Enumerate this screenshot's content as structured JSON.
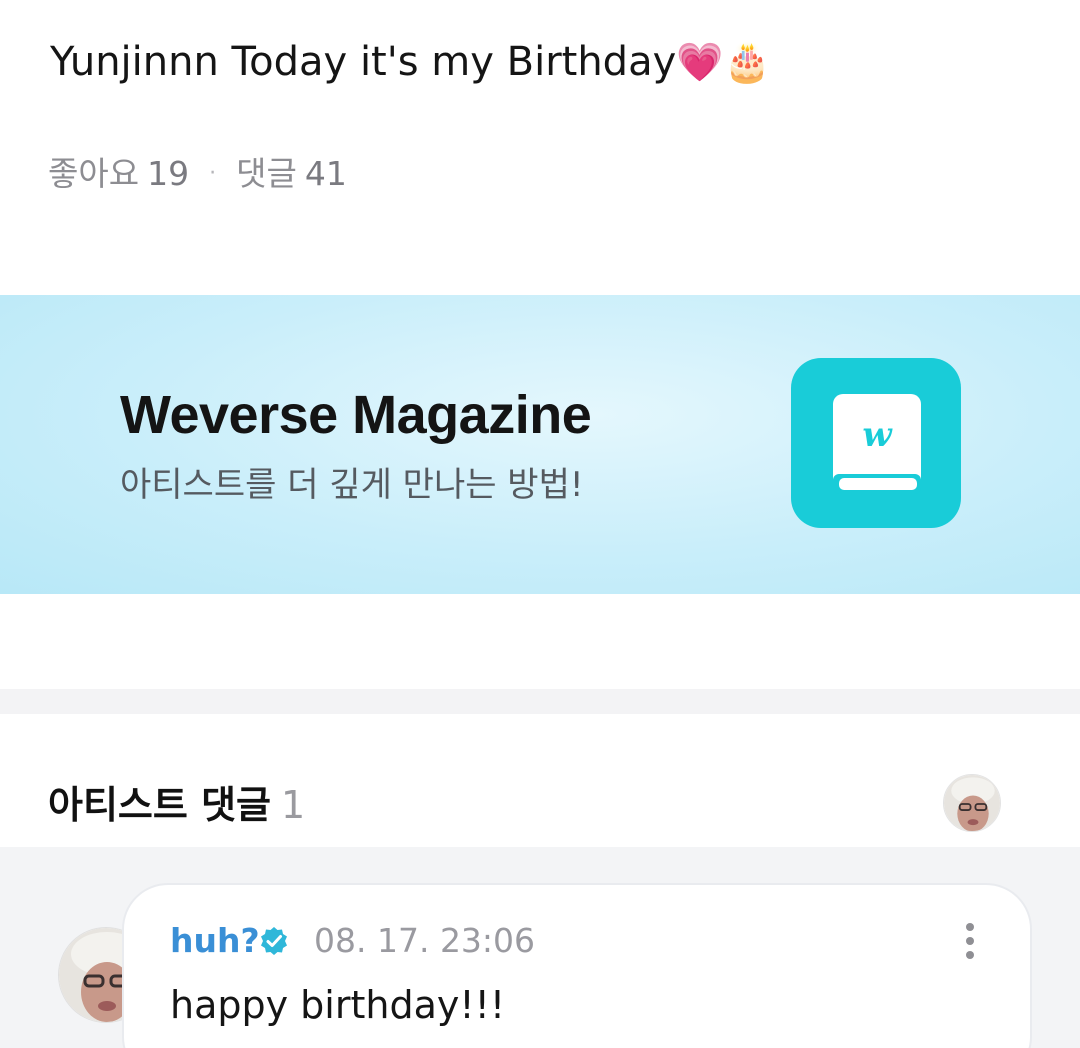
{
  "post": {
    "text": "Yunjinnn Today it's my Birthday",
    "emoji_heart": "💗",
    "emoji_cake": "🎂",
    "likes_label": "좋아요",
    "likes_count": "19",
    "separator": "·",
    "comments_label": "댓글",
    "comments_count": "41"
  },
  "banner": {
    "title": "Weverse Magazine",
    "subtitle": "아티스트를 더 깊게 만나는 방법!",
    "icon_name": "weverse-magazine-book-icon",
    "icon_bg": "#19ccd8"
  },
  "artist_comments": {
    "title": "아티스트 댓글",
    "count": "1"
  },
  "comment": {
    "author": "huh?",
    "timestamp": "08. 17. 23:06",
    "body": "happy birthday!!!",
    "author_color": "#3a8fd6"
  }
}
